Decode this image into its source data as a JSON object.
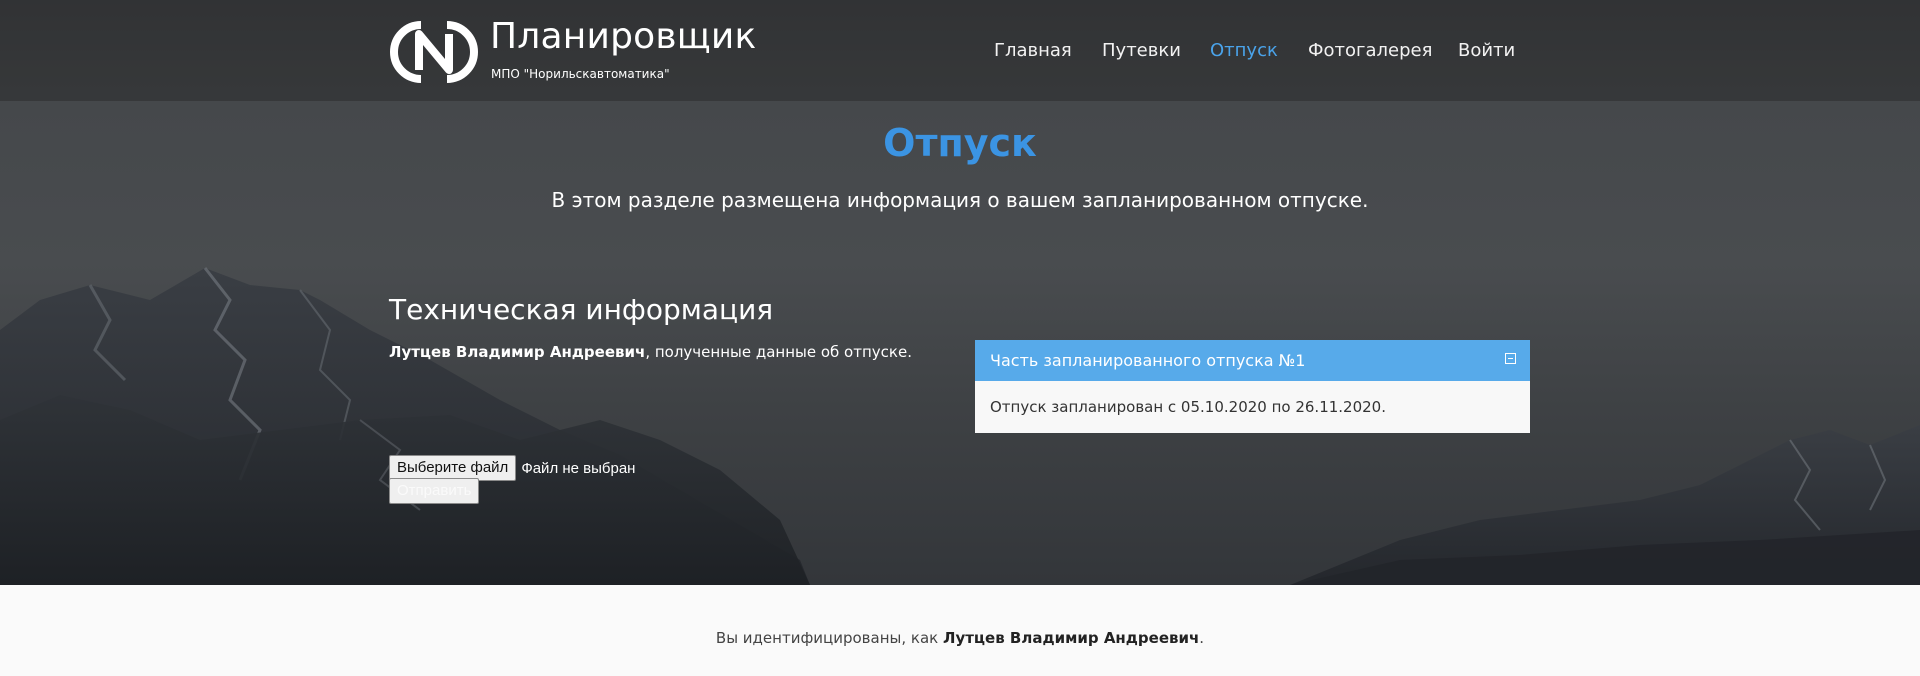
{
  "brand": {
    "title": "Планировщик",
    "subtitle": "МПО \"Норильскавтоматика\""
  },
  "nav": {
    "home": "Главная",
    "trips": "Путевки",
    "vacation": "Отпуск",
    "gallery": "Фотогалерея",
    "login": "Войти",
    "active_color": "#4aa3ea"
  },
  "hero": {
    "title": "Отпуск",
    "lead": "В этом разделе размещена информация о вашем запланированном отпуске."
  },
  "tech": {
    "title": "Техническая информация",
    "user_name": "Лутцев Владимир Андреевич",
    "user_suffix": ", полученные данные об отпуске."
  },
  "upload": {
    "choose_label": "Выберите файл",
    "status": "Файл не выбран",
    "submit_label": "Отправить"
  },
  "panel": {
    "title": "Часть запланированного отпуска №1",
    "body": "Отпуск запланирован с 05.10.2020 по 26.11.2020.",
    "header_color": "#57aaea"
  },
  "footer": {
    "prefix": "Вы идентифицированы, как ",
    "user_name": "Лутцев Владимир Андреевич",
    "suffix": "."
  }
}
